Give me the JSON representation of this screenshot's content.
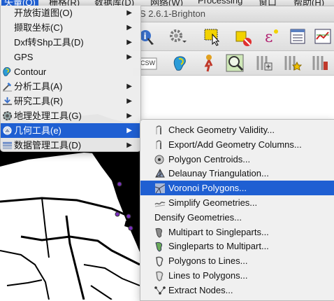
{
  "menubar": {
    "items": [
      {
        "label": "矢量(O)",
        "active": true
      },
      {
        "label": "栅格(R)",
        "active": false
      },
      {
        "label": "数据库(D)",
        "active": false
      },
      {
        "label": "网络(W)",
        "active": false
      },
      {
        "label": "Processing",
        "active": false
      },
      {
        "label": "窗口",
        "active": false
      },
      {
        "label": "帮助(H)",
        "active": false
      }
    ]
  },
  "window": {
    "title_visible": "S 2.6.1-Brighton"
  },
  "toolbar": {
    "csw_label": "CSW"
  },
  "vector_menu": {
    "items": [
      {
        "label": "开放街道图(O)",
        "icon": "",
        "submenu": true
      },
      {
        "label": "撷取坐标(C)",
        "icon": "",
        "submenu": true
      },
      {
        "label": "Dxf转Shp工具(D)",
        "icon": "",
        "submenu": true
      },
      {
        "label": "GPS",
        "icon": "",
        "submenu": true
      },
      {
        "label": "Contour",
        "icon": "contour-icon",
        "submenu": false
      },
      {
        "label": "分析工具(A)",
        "icon": "analysis-tools-icon",
        "submenu": true
      },
      {
        "label": "研究工具(R)",
        "icon": "research-tools-icon",
        "submenu": true
      },
      {
        "label": "地理处理工具(G)",
        "icon": "geoprocessing-icon",
        "submenu": true
      },
      {
        "label": "几何工具(e)",
        "icon": "geometry-tools-icon",
        "submenu": true,
        "selected": true
      },
      {
        "label": "数据管理工具(D)",
        "icon": "data-management-icon",
        "submenu": true
      }
    ]
  },
  "geometry_submenu": {
    "items": [
      {
        "label": "Check Geometry Validity...",
        "icon": "check-geometry-icon"
      },
      {
        "label": "Export/Add Geometry Columns...",
        "icon": "export-geometry-icon"
      },
      {
        "label": "Polygon Centroids...",
        "icon": "centroids-icon"
      },
      {
        "label": "Delaunay Triangulation...",
        "icon": "delaunay-icon"
      },
      {
        "label": "Voronoi Polygons...",
        "icon": "voronoi-icon",
        "selected": true
      },
      {
        "label": "Simplify Geometries...",
        "icon": "simplify-icon"
      },
      {
        "label": "Densify Geometries...",
        "icon": ""
      },
      {
        "label": "Multipart to Singleparts...",
        "icon": "multipart-icon"
      },
      {
        "label": "Singleparts to Multipart...",
        "icon": "singleparts-icon"
      },
      {
        "label": "Polygons to Lines...",
        "icon": "polygons-to-lines-icon"
      },
      {
        "label": "Lines to Polygons...",
        "icon": "lines-to-polygons-icon"
      },
      {
        "label": "Extract Nodes...",
        "icon": "extract-nodes-icon"
      }
    ]
  },
  "colors": {
    "selection": "#1f5fd2",
    "map_land": "#000000",
    "map_points": "#7b2fbf"
  }
}
